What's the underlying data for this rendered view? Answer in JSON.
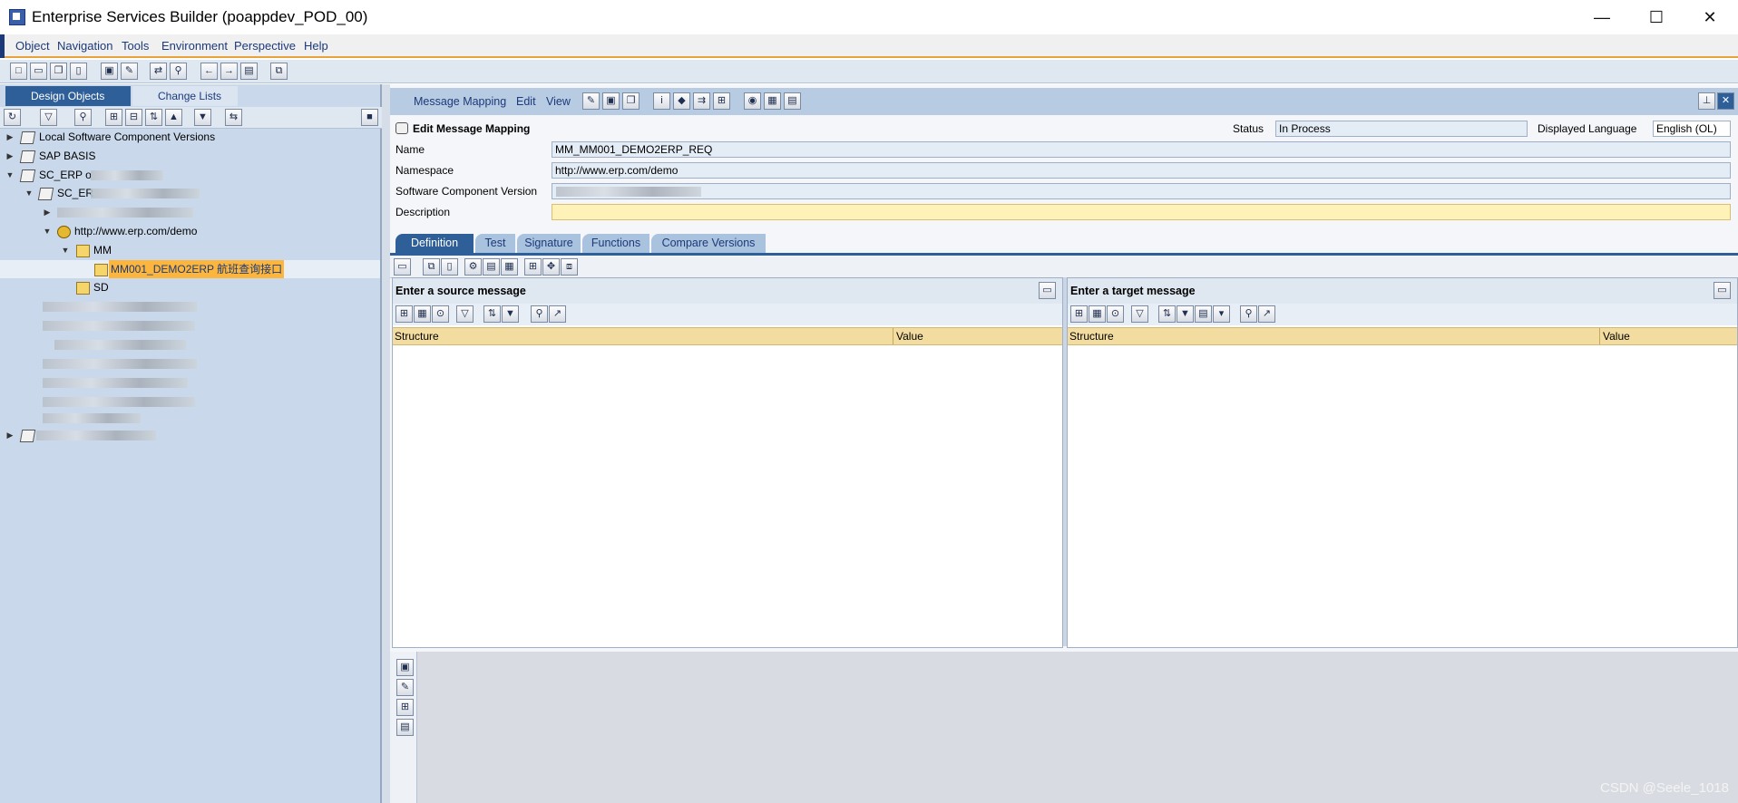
{
  "window": {
    "title": "Enterprise Services Builder (poappdev_POD_00)",
    "minimize": "—",
    "maximize": "☐",
    "close": "✕"
  },
  "menu": [
    "Object",
    "Navigation",
    "Tools",
    "Environment",
    "Perspective",
    "Help"
  ],
  "left_panel": {
    "tabs": [
      "Design Objects",
      "Change Lists"
    ],
    "tree": {
      "local_scv": "Local Software Component Versions",
      "sap_basis": "SAP BASIS",
      "sc_erp": "SC_ERP o",
      "sc_erp_child": "SC_ER",
      "namespace": "http://www.erp.com/demo",
      "folder_mm": "MM",
      "selected_item": "MM001_DEMO2ERP 航班查询接口",
      "folder_sd": "SD"
    }
  },
  "editor": {
    "menus": [
      "Message Mapping",
      "Edit",
      "View"
    ],
    "heading": "Edit Message Mapping",
    "status_label": "Status",
    "status_value": "In Process",
    "language_label": "Displayed Language",
    "language_value": "English (OL)",
    "name_label": "Name",
    "name_value": "MM_MM001_DEMO2ERP_REQ",
    "namespace_label": "Namespace",
    "namespace_value": "http://www.erp.com/demo",
    "scv_label": "Software Component Version",
    "description_label": "Description",
    "description_value": "",
    "tabs": [
      "Definition",
      "Test",
      "Signature",
      "Functions",
      "Compare Versions"
    ]
  },
  "source_pane": {
    "title": "Enter a source message",
    "col_structure": "Structure",
    "col_value": "Value"
  },
  "target_pane": {
    "title": "Enter a target message",
    "col_structure": "Structure",
    "col_value": "Value"
  },
  "watermark": "CSDN @Seele_1018",
  "colors": {
    "accent": "#2f5f98",
    "selection": "#fdb63d",
    "header_band": "#f3dca0",
    "description_field": "#fff2b8"
  }
}
